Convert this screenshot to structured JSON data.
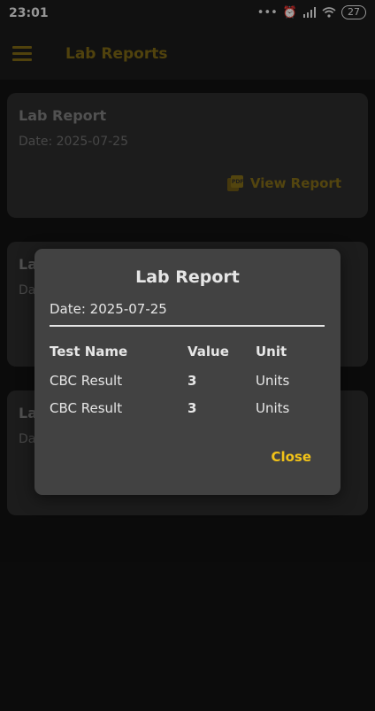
{
  "status_bar": {
    "time": "23:01",
    "icons": [
      "dots-icon",
      "alarm-icon",
      "signal-icon",
      "wifi-icon"
    ],
    "battery": "27"
  },
  "app_bar": {
    "title": "Lab Reports",
    "menu_icon": "hamburger-menu-icon"
  },
  "cards": [
    {
      "title": "Lab Report",
      "date": "Date: 2025-07-25",
      "action": "View Report"
    },
    {
      "title": "La",
      "date": "Da"
    },
    {
      "title": "La",
      "date": "Da"
    }
  ],
  "dialog": {
    "title": "Lab Report",
    "date": "Date: 2025-07-25",
    "columns": [
      "Test Name",
      "Value",
      "Unit"
    ],
    "rows": [
      {
        "name": "CBC Result",
        "value": "3",
        "unit": "Units"
      },
      {
        "name": "CBC Result",
        "value": "3",
        "unit": "Units"
      }
    ],
    "close_label": "Close"
  },
  "colors": {
    "background": "#121212",
    "accent_dim": "#7b6615",
    "accent": "#f2c318",
    "dialog_bg": "#424242",
    "card_bg": "#2c2c2c"
  }
}
